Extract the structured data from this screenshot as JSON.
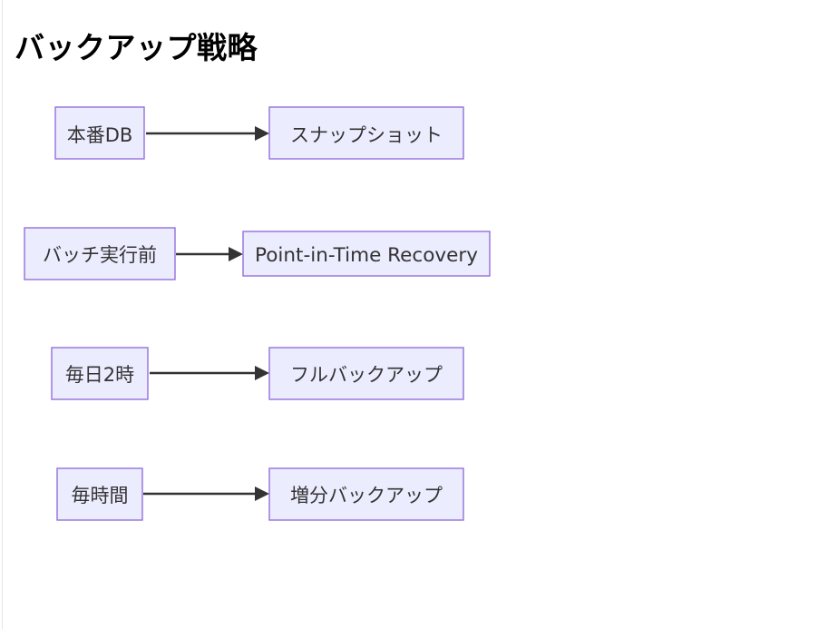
{
  "title": "バックアップ戦略",
  "colors": {
    "node_fill": "#ececff",
    "node_border": "#9370db",
    "edge": "#333333",
    "text": "#333333"
  },
  "diagram": {
    "type": "flowchart",
    "direction": "LR",
    "rows": [
      {
        "from": "本番DB",
        "to": "スナップショット"
      },
      {
        "from": "バッチ実行前",
        "to": "Point-in-Time Recovery"
      },
      {
        "from": "毎日2時",
        "to": "フルバックアップ"
      },
      {
        "from": "毎時間",
        "to": "増分バックアップ"
      }
    ]
  }
}
